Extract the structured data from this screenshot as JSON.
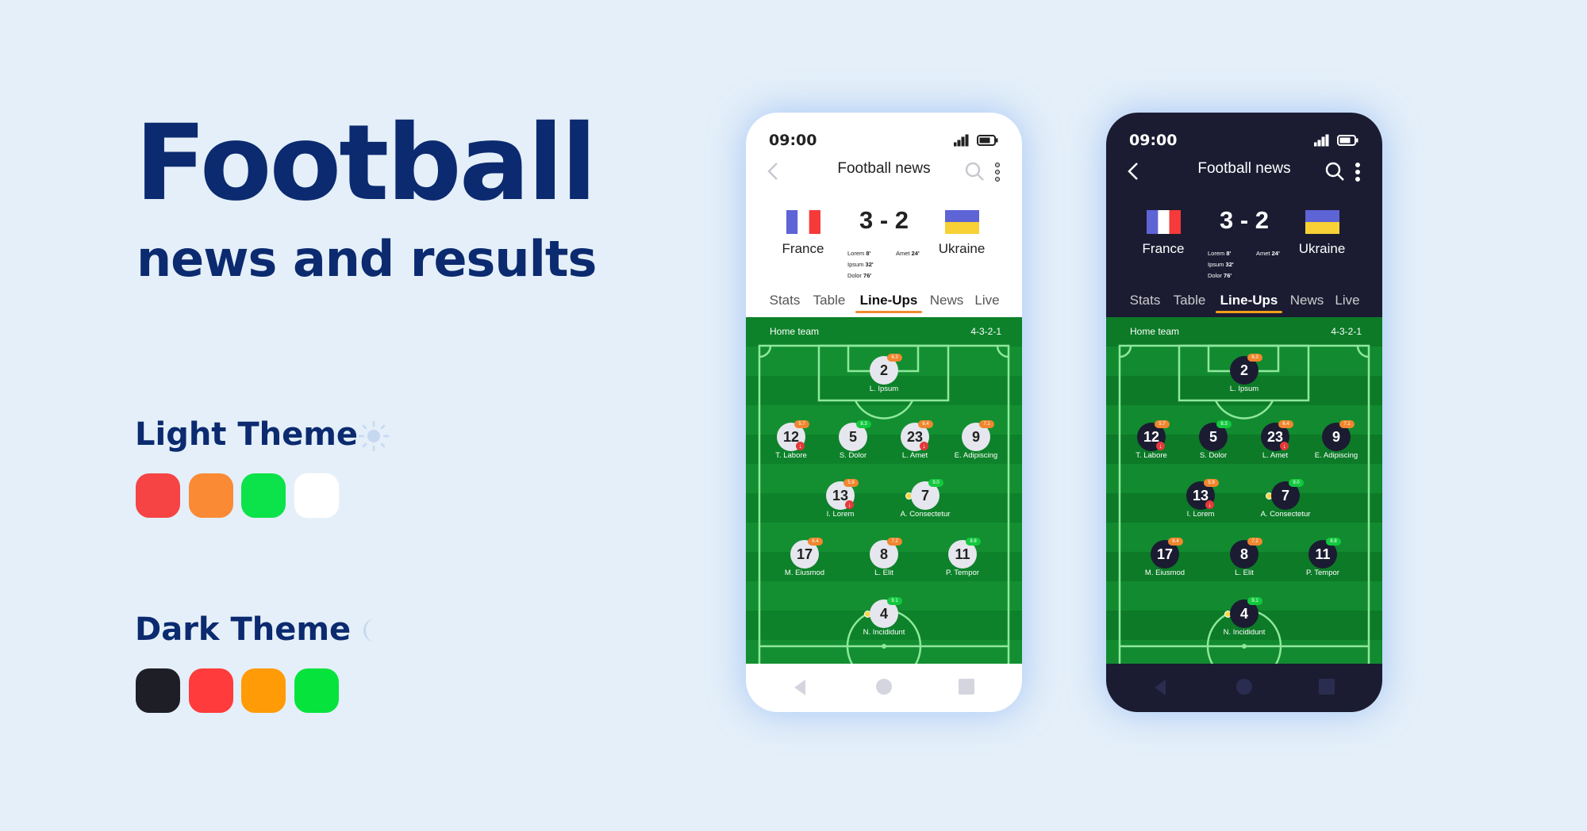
{
  "headline": {
    "title": "Football",
    "subtitle": "news and results"
  },
  "themes": [
    {
      "label": "Light Theme",
      "icon": "sun-icon",
      "colors": [
        "#f64444",
        "#fb8a35",
        "#0ce24a",
        "#ffffff"
      ]
    },
    {
      "label": "Dark Theme",
      "icon": "moon-icon",
      "colors": [
        "#1e1e26",
        "#ff3b3b",
        "#ff9b06",
        "#06e33d"
      ]
    }
  ],
  "app": {
    "status_time": "09:00",
    "header_title": "Football news",
    "match": {
      "home_team": "France",
      "away_team": "Ukraine",
      "score": "3 - 2",
      "home_scorers": [
        {
          "name": "Lorem",
          "minute": "8'"
        },
        {
          "name": "Ipsum",
          "minute": "32'"
        },
        {
          "name": "Dolor",
          "minute": "76'"
        }
      ],
      "away_scorers": [
        {
          "name": "Amet",
          "minute": "24'"
        }
      ]
    },
    "tabs": [
      "Stats",
      "Table",
      "Line-Ups",
      "News",
      "Live"
    ],
    "active_tab": "Line-Ups",
    "lineup": {
      "team_label": "Home team",
      "formation": "4-3-2-1",
      "players": [
        {
          "number": "2",
          "name": "L. Ipsum",
          "rating": "6.3",
          "rating_level": "orange",
          "subbed_off": false,
          "yellow_card": false
        },
        {
          "number": "12",
          "name": "T. Labore",
          "rating": "5.7",
          "rating_level": "orange",
          "subbed_off": true,
          "yellow_card": false
        },
        {
          "number": "5",
          "name": "S. Dolor",
          "rating": "8.3",
          "rating_level": "green",
          "subbed_off": false,
          "yellow_card": false
        },
        {
          "number": "23",
          "name": "L. Amet",
          "rating": "6.4",
          "rating_level": "orange",
          "subbed_off": true,
          "yellow_card": false
        },
        {
          "number": "9",
          "name": "E. Adipiscing",
          "rating": "7.1",
          "rating_level": "orange",
          "subbed_off": false,
          "yellow_card": false
        },
        {
          "number": "13",
          "name": "I. Lorem",
          "rating": "5.9",
          "rating_level": "orange",
          "subbed_off": true,
          "yellow_card": false
        },
        {
          "number": "7",
          "name": "A. Consectetur",
          "rating": "9.0",
          "rating_level": "green",
          "subbed_off": false,
          "yellow_card": true
        },
        {
          "number": "17",
          "name": "M. Eiusmod",
          "rating": "6.4",
          "rating_level": "orange",
          "subbed_off": false,
          "yellow_card": false
        },
        {
          "number": "8",
          "name": "L. Elit",
          "rating": "7.2",
          "rating_level": "orange",
          "subbed_off": false,
          "yellow_card": false
        },
        {
          "number": "11",
          "name": "P. Tempor",
          "rating": "8.8",
          "rating_level": "green",
          "subbed_off": false,
          "yellow_card": false
        },
        {
          "number": "4",
          "name": "N. Incididunt",
          "rating": "9.1",
          "rating_level": "green",
          "subbed_off": false,
          "yellow_card": true
        }
      ]
    },
    "colors": {
      "orange": "#f0862e",
      "green": "#12c93e",
      "tab_underline": "#f08a30"
    }
  }
}
